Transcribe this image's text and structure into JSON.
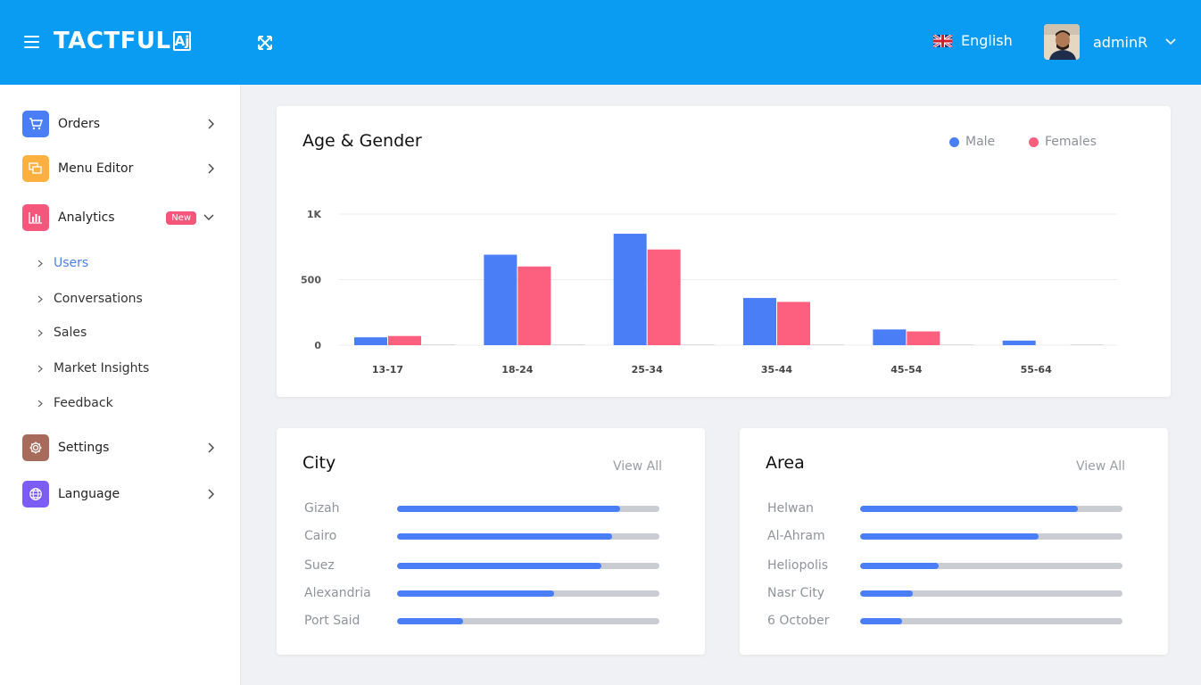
{
  "header": {
    "logo_text": "TACTFUL",
    "logo_suffix": "Aj",
    "language": "English",
    "username": "adminR"
  },
  "sidebar": {
    "items": [
      {
        "label": "Orders",
        "icon": "cart-icon",
        "color": "#4a7ef7"
      },
      {
        "label": "Menu Editor",
        "icon": "layers-icon",
        "color": "#fbb040"
      },
      {
        "label": "Analytics",
        "icon": "bar-chart-icon",
        "color": "#f4577b",
        "badge": "New"
      },
      {
        "label": "Settings",
        "icon": "gear-icon",
        "color": "#a86b5b"
      },
      {
        "label": "Language",
        "icon": "globe-icon",
        "color": "#7b5cf5"
      }
    ],
    "analytics_sub": [
      "Users",
      "Conversations",
      "Sales",
      "Market Insights",
      "Feedback"
    ],
    "active_sub": "Users"
  },
  "age_gender": {
    "title": "Age & Gender",
    "legend": [
      {
        "name": "Male",
        "color": "#4a7ef7"
      },
      {
        "name": "Females",
        "color": "#fd5f7e"
      }
    ]
  },
  "chart_data": {
    "type": "bar",
    "title": "Age & Gender",
    "categories": [
      "13-17",
      "18-24",
      "25-34",
      "35-44",
      "45-54",
      "55-64"
    ],
    "series": [
      {
        "name": "Male",
        "values": [
          60,
          690,
          850,
          360,
          120,
          35
        ]
      },
      {
        "name": "Females",
        "values": [
          70,
          600,
          730,
          330,
          105,
          0
        ]
      }
    ],
    "yticks": [
      "0",
      "500",
      "1K"
    ],
    "ylim": [
      0,
      1000
    ],
    "grid": true,
    "legend_position": "top-right"
  },
  "city": {
    "title": "City",
    "view_all": "View All",
    "rows": [
      {
        "label": "Gizah",
        "value": 0.85
      },
      {
        "label": "Cairo",
        "value": 0.82
      },
      {
        "label": "Suez",
        "value": 0.78
      },
      {
        "label": "Alexandria",
        "value": 0.6
      },
      {
        "label": "Port Said",
        "value": 0.25
      }
    ]
  },
  "area": {
    "title": "Area",
    "view_all": "View All",
    "rows": [
      {
        "label": "Helwan",
        "value": 0.83
      },
      {
        "label": "Al-Ahram",
        "value": 0.68
      },
      {
        "label": "Heliopolis",
        "value": 0.3
      },
      {
        "label": "Nasr City",
        "value": 0.2
      },
      {
        "label": "6 October",
        "value": 0.16
      }
    ]
  }
}
